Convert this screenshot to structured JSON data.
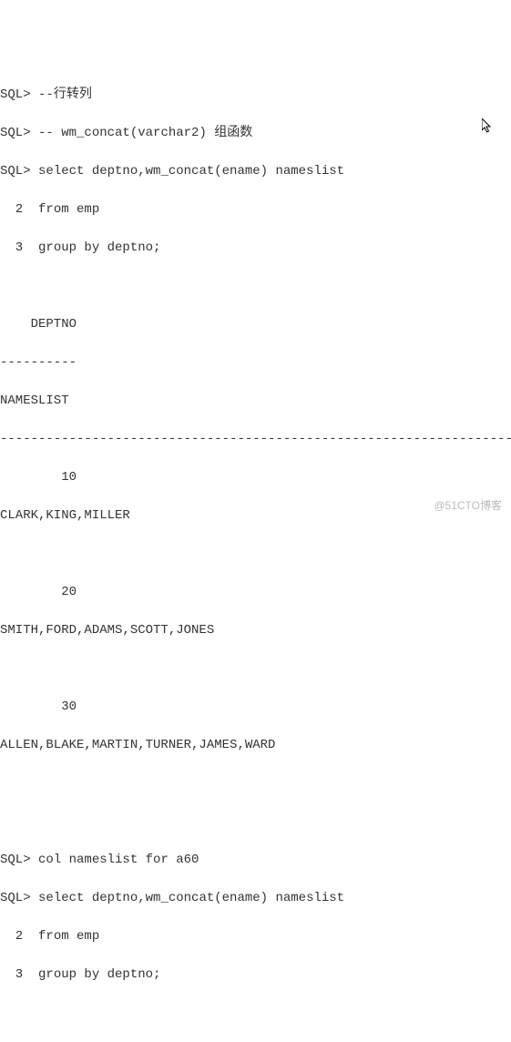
{
  "prompt": "SQL>",
  "line_prefix_2": "  2 ",
  "line_prefix_3": "  3 ",
  "block1": {
    "l1": "--行转列",
    "l2": "-- wm_concat(varchar2) 组函数",
    "l3": "select deptno,wm_concat(ename) nameslist",
    "l4": "from emp",
    "l5": "group by deptno;"
  },
  "result": {
    "header1": "    DEPTNO",
    "dashes1": "----------",
    "header2": "NAMESLIST",
    "dashes2": "--------------------------------------------------------------------------------",
    "rows": [
      {
        "deptno": "        10",
        "nameslist": "CLARK,KING,MILLER"
      },
      {
        "deptno": "        20",
        "nameslist": "SMITH,FORD,ADAMS,SCOTT,JONES"
      },
      {
        "deptno": "        30",
        "nameslist": "ALLEN,BLAKE,MARTIN,TURNER,JAMES,WARD"
      }
    ]
  },
  "block2": {
    "l1": "col nameslist for a60",
    "l2": "select deptno,wm_concat(ename) nameslist",
    "l3": "from emp",
    "l4": "group by deptno;"
  },
  "watermark": "@51CTO博客"
}
